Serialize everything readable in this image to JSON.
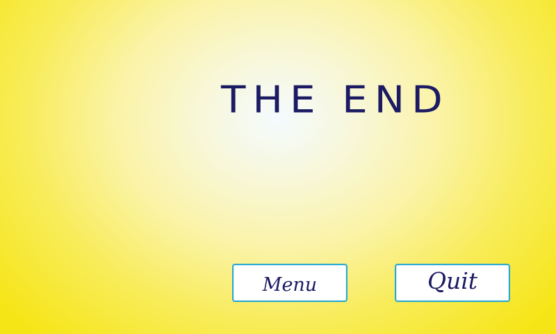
{
  "end_screen": {
    "title": "THE END"
  },
  "buttons": {
    "menu_label": "Menu",
    "quit_label": "Quit"
  },
  "colors": {
    "background_center": "#f4fbff",
    "background_edge": "#f6e516",
    "text": "#1b1a63",
    "button_border": "#2aa9cf",
    "button_fill": "#ffffff"
  }
}
